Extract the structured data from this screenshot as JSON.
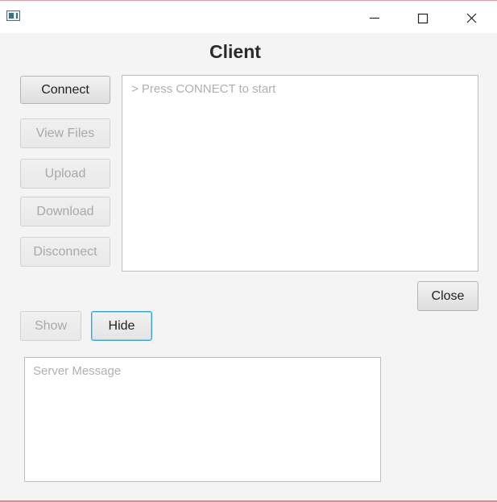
{
  "window": {
    "title_bar": {
      "minimize_icon": "minimize-icon",
      "maximize_icon": "maximize-icon",
      "close_icon": "close-icon"
    },
    "heading": "Client"
  },
  "actions": {
    "connect": "Connect",
    "view_files": "View Files",
    "upload": "Upload",
    "download": "Download",
    "disconnect": "Disconnect",
    "close": "Close",
    "show": "Show",
    "hide": "Hide"
  },
  "console": {
    "placeholder": "> Press CONNECT to start"
  },
  "server": {
    "placeholder": "Server Message"
  },
  "colors": {
    "background": "#f4f4f4",
    "focus_ring": "#3aa4d8",
    "disabled_text": "#a8a8a8"
  }
}
